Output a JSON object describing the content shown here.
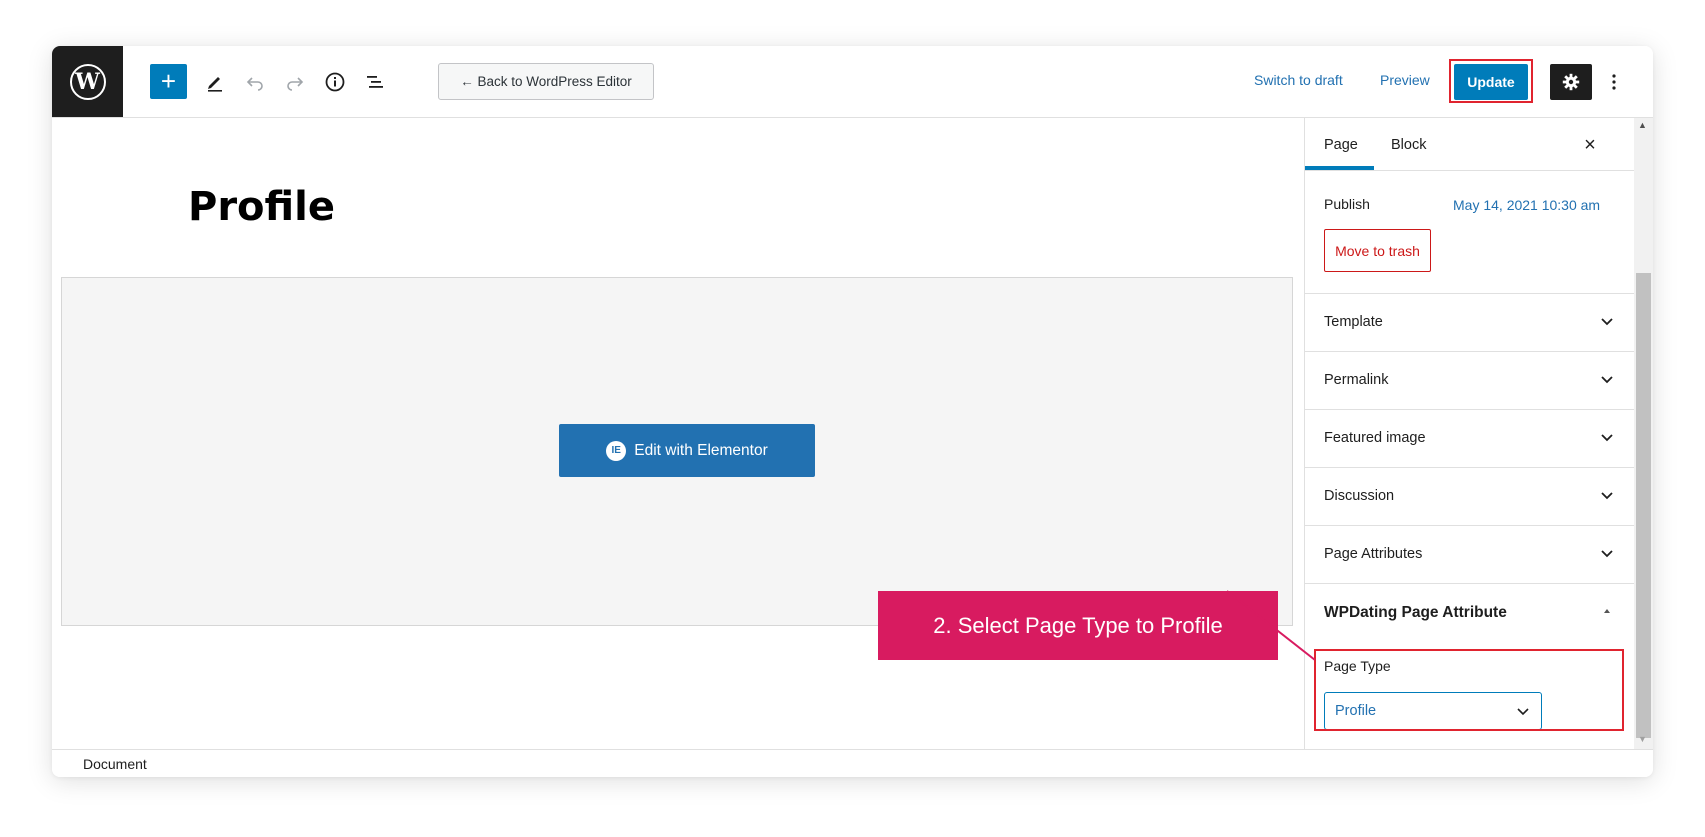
{
  "toolbar": {
    "logo_icon": "wordpress-logo-icon",
    "add_block_label": "+",
    "back_button_label": "← Back to WordPress Editor",
    "switch_to_draft_label": "Switch to draft",
    "preview_label": "Preview",
    "update_label": "Update",
    "icons": [
      "plus-icon",
      "pencil-icon",
      "undo-icon",
      "redo-icon",
      "info-icon",
      "list-view-icon",
      "gear-icon",
      "more-vertical-icon"
    ],
    "accent_color": "#007cba"
  },
  "editor": {
    "page_title": "Profile",
    "elementor_button_label": "Edit with Elementor",
    "elementor_icon_glyph": "IE"
  },
  "annotation": {
    "text": "2. Select Page Type to Profile",
    "color": "#d81b60"
  },
  "sidebar": {
    "tabs": [
      {
        "label": "Page",
        "active": true
      },
      {
        "label": "Block",
        "active": false
      }
    ],
    "close_label": "×",
    "publish": {
      "label": "Publish",
      "date": "May 14, 2021 10:30 am"
    },
    "trash_label": "Move to trash",
    "panels": [
      {
        "label": "Template",
        "open": false
      },
      {
        "label": "Permalink",
        "open": false
      },
      {
        "label": "Featured image",
        "open": false
      },
      {
        "label": "Discussion",
        "open": false
      },
      {
        "label": "Page Attributes",
        "open": false
      },
      {
        "label": "WPDating Page Attribute",
        "open": true
      }
    ],
    "page_type": {
      "label": "Page Type",
      "selected": "Profile"
    },
    "highlight_color": "#e0242f"
  },
  "footer": {
    "breadcrumb": "Document"
  }
}
